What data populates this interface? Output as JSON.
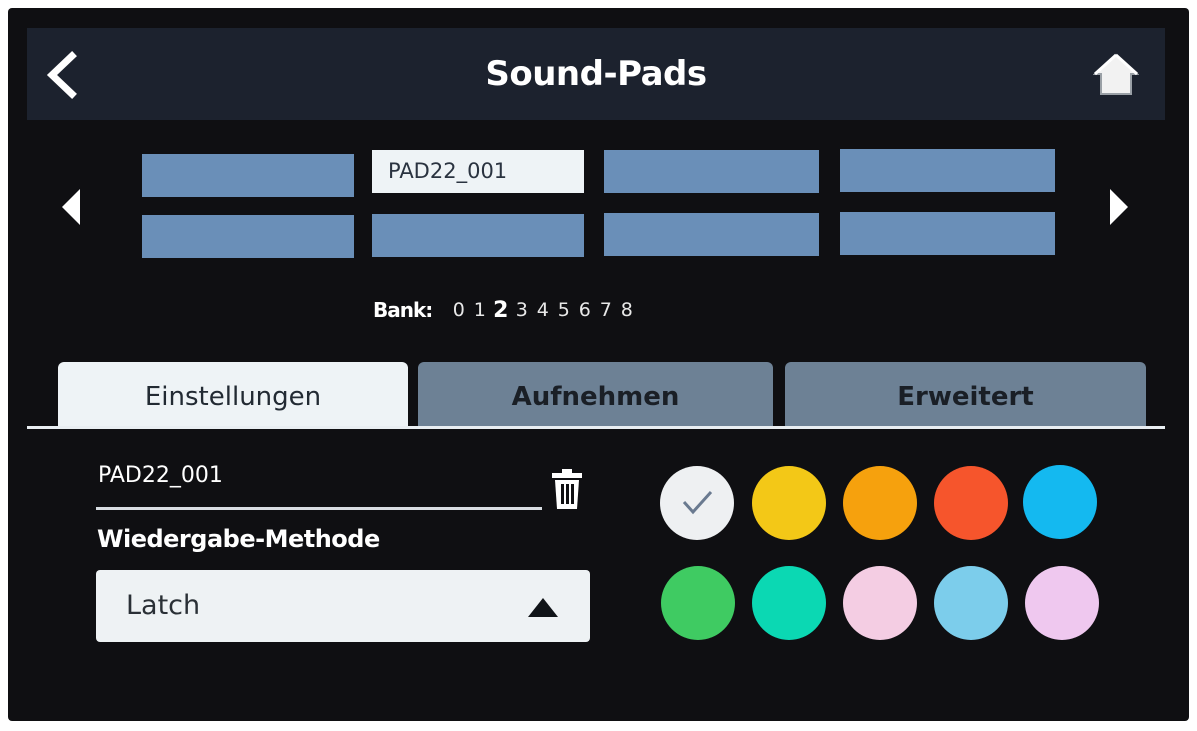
{
  "header": {
    "title": "Sound-Pads",
    "back_icon": "chevron-left-icon",
    "home_icon": "home-icon"
  },
  "pads": {
    "prev_icon": "triangle-left-icon",
    "next_icon": "triangle-right-icon",
    "row1": [
      "",
      "PAD22_001",
      "",
      ""
    ],
    "row2": [
      "",
      "",
      "",
      ""
    ],
    "selected_index": 1,
    "pad_color": "#6a8fb8",
    "selected_color": "#eef3f6"
  },
  "bank": {
    "label": "Bank:",
    "numbers": [
      "0",
      "1",
      "2",
      "3",
      "4",
      "5",
      "6",
      "7",
      "8"
    ],
    "active": "2"
  },
  "tabs": [
    {
      "label": "Einstellungen",
      "active": true
    },
    {
      "label": "Aufnehmen",
      "active": false
    },
    {
      "label": "Erweitert",
      "active": false
    }
  ],
  "settings": {
    "pad_name": "PAD22_001",
    "delete_icon": "trash-icon",
    "method_label": "Wiedergabe-Methode",
    "method_value": "Latch",
    "dropdown_icon": "triangle-up-icon"
  },
  "colors": {
    "selected_index": 0,
    "check_icon": "check-icon",
    "swatches": [
      "#eef0f2",
      "#f3c817",
      "#f6a10d",
      "#f6552c",
      "#14b9f0",
      "#3fcb62",
      "#0bd8b3",
      "#f4cde3",
      "#7ccdeb",
      "#efc8ef"
    ]
  }
}
